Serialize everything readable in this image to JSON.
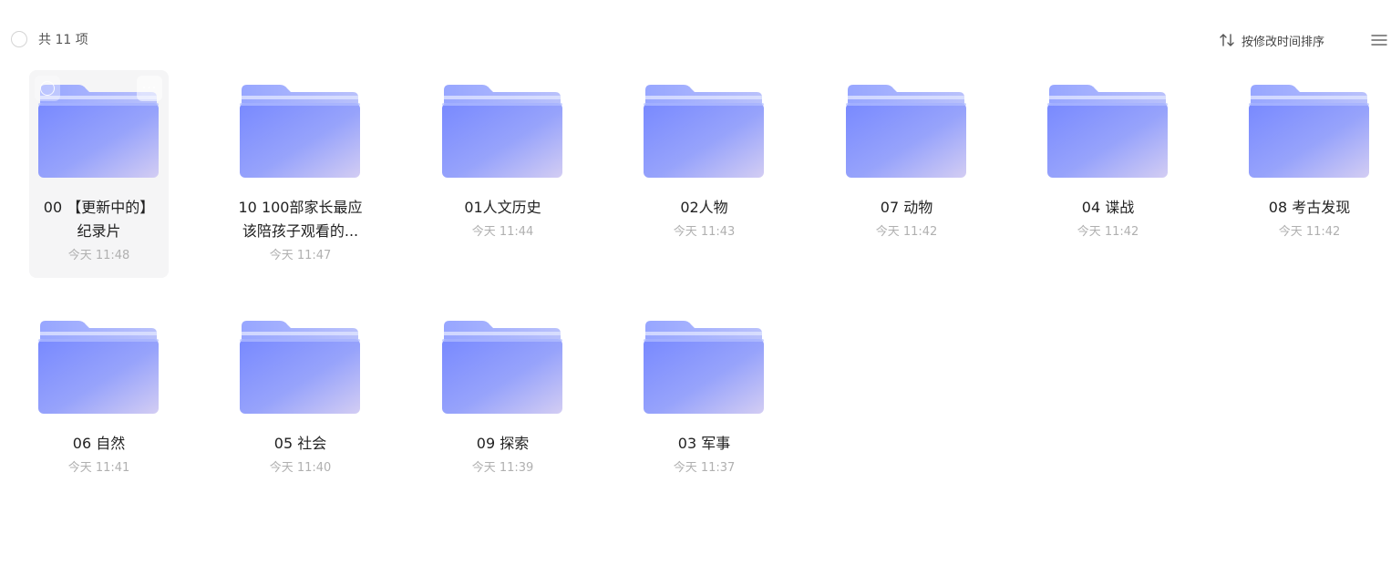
{
  "header": {
    "count_label": "共 11 项",
    "sort_label": "按修改时间排序",
    "icons": {
      "select_all": "circle-checkbox-icon",
      "sort": "sort-arrows-icon",
      "view": "list-view-icon"
    }
  },
  "colors": {
    "folder_front_start": "#7f92ff",
    "folder_front_end": "#cbc7f4",
    "folder_back": "#a5b2ff",
    "time_text": "#b0b0b0"
  },
  "folders": [
    {
      "name_line1": "00 【更新中的】",
      "name_line2": "纪录片",
      "time": "今天 11:48"
    },
    {
      "name_line1": "10 100部家长最应",
      "name_line2": "该陪孩子观看的...",
      "time": "今天 11:47"
    },
    {
      "name_line1": "01人文历史",
      "name_line2": "",
      "time": "今天 11:44"
    },
    {
      "name_line1": "02人物",
      "name_line2": "",
      "time": "今天 11:43"
    },
    {
      "name_line1": "07 动物",
      "name_line2": "",
      "time": "今天 11:42"
    },
    {
      "name_line1": "04 谍战",
      "name_line2": "",
      "time": "今天 11:42"
    },
    {
      "name_line1": "08 考古发现",
      "name_line2": "",
      "time": "今天 11:42"
    },
    {
      "name_line1": "06 自然",
      "name_line2": "",
      "time": "今天 11:41"
    },
    {
      "name_line1": "05 社会",
      "name_line2": "",
      "time": "今天 11:40"
    },
    {
      "name_line1": "09 探索",
      "name_line2": "",
      "time": "今天 11:39"
    },
    {
      "name_line1": "03 军事",
      "name_line2": "",
      "time": "今天 11:37"
    }
  ]
}
